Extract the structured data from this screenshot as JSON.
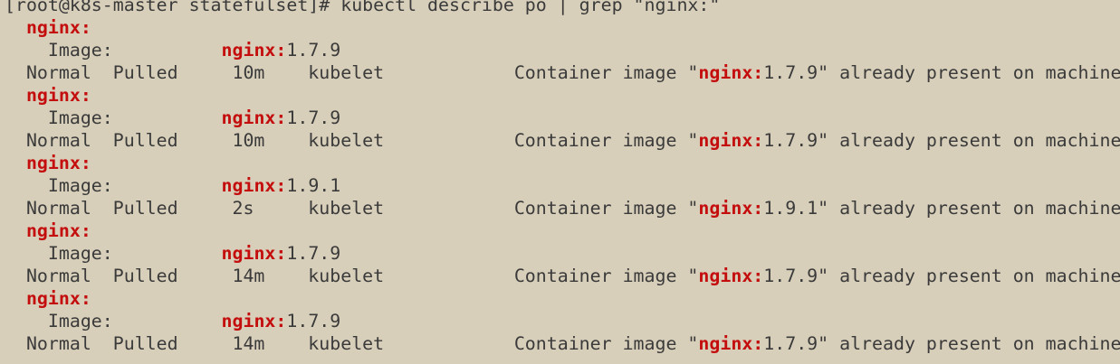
{
  "terminal": {
    "prompt_line": "[root@k8s-master statefulset]# kubectl describe po | grep \"nginx:\"",
    "match": "nginx:",
    "blocks": [
      {
        "name_line_prefix": "  ",
        "image_label": "    Image:          ",
        "image_version": "1.7.9",
        "event_prefix": "  Normal  Pulled     10m    kubelet            Container image \"",
        "event_suffix": "1.7.9\" already present on machine"
      },
      {
        "name_line_prefix": "  ",
        "image_label": "    Image:          ",
        "image_version": "1.7.9",
        "event_prefix": "  Normal  Pulled     10m    kubelet            Container image \"",
        "event_suffix": "1.7.9\" already present on machine"
      },
      {
        "name_line_prefix": "  ",
        "image_label": "    Image:          ",
        "image_version": "1.9.1",
        "event_prefix": "  Normal  Pulled     2s     kubelet            Container image \"",
        "event_suffix": "1.9.1\" already present on machine"
      },
      {
        "name_line_prefix": "  ",
        "image_label": "    Image:          ",
        "image_version": "1.7.9",
        "event_prefix": "  Normal  Pulled     14m    kubelet            Container image \"",
        "event_suffix": "1.7.9\" already present on machine"
      },
      {
        "name_line_prefix": "  ",
        "image_label": "    Image:          ",
        "image_version": "1.7.9",
        "event_prefix": "  Normal  Pulled     14m    kubelet            Container image \"",
        "event_suffix": "1.7.9\" already present on machine"
      }
    ],
    "colors": {
      "background": "#d8cfba",
      "text": "#3a3a3a",
      "highlight": "#c40e0e"
    }
  }
}
